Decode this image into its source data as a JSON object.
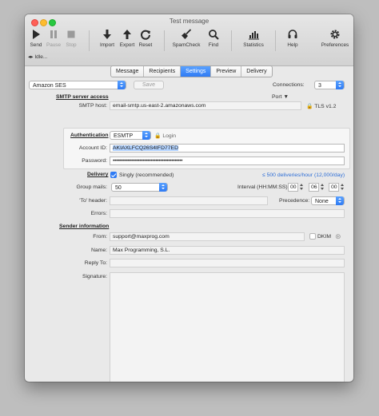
{
  "window": {
    "title": "Test message"
  },
  "toolbar": [
    {
      "label": "Send",
      "icon": "play-icon",
      "enabled": true
    },
    {
      "label": "Pause",
      "icon": "pause-icon",
      "enabled": false
    },
    {
      "label": "Stop",
      "icon": "stop-icon",
      "enabled": false
    },
    {
      "label": "Import",
      "icon": "arrow-down-icon",
      "enabled": true
    },
    {
      "label": "Export",
      "icon": "arrow-up-icon",
      "enabled": true
    },
    {
      "label": "Reset",
      "icon": "refresh-icon",
      "enabled": true
    },
    {
      "label": "SpamCheck",
      "icon": "broom-icon",
      "enabled": true
    },
    {
      "label": "Find",
      "icon": "search-icon",
      "enabled": true
    },
    {
      "label": "Statistics",
      "icon": "bar-chart-icon",
      "enabled": true
    },
    {
      "label": "Help",
      "icon": "headset-icon",
      "enabled": true
    },
    {
      "label": "Preferences",
      "icon": "gear-icon",
      "enabled": true
    }
  ],
  "status": {
    "text": "Idle..."
  },
  "tabs": [
    {
      "label": "Message",
      "active": false
    },
    {
      "label": "Recipients",
      "active": false
    },
    {
      "label": "Settings",
      "active": true
    },
    {
      "label": "Preview",
      "active": false
    },
    {
      "label": "Delivery",
      "active": false
    }
  ],
  "settings": {
    "profile": "Amazon SES",
    "save_label": "Save",
    "connections_label": "Connections:",
    "connections_value": "3",
    "smtp_section": "SMTP server access",
    "port_label": "Port ▼",
    "smtp_host_label": "SMTP host:",
    "smtp_host_value": "email-smtp.us-east-2.amazonaws.com",
    "tls_label": "TLS v1.2",
    "auth_label": "Authentication",
    "auth_value": "ESMTP",
    "login_label": "Login",
    "account_id_label": "Account ID:",
    "account_id_value": "AKIAXLFCQ26S4IFD77ED",
    "password_label": "Password:",
    "password_value": "••••••••••••••••••••••••••••••••••••••••••••",
    "delivery_section": "Delivery",
    "singly_label": "Singly (recommended)",
    "rate_text": "≤ 500 deliveries/hour (12,000/day)",
    "group_mails_label": "Group mails:",
    "group_mails_value": "50",
    "interval_label": "Interval (HH:MM:SS):",
    "interval_h": "00",
    "interval_m": "06",
    "interval_s": "00",
    "to_header_label": "'To' header:",
    "precedence_label": "Precedence:",
    "precedence_value": "None",
    "errors_label": "Errors:",
    "sender_section": "Sender information",
    "from_label": "From:",
    "from_value": "support@maxprog.com",
    "dkim_label": "DKIM",
    "name_label": "Name:",
    "name_value": "Max Programming, S.L.",
    "reply_to_label": "Reply To:",
    "signature_label": "Signature:"
  },
  "colors": {
    "accent": "#2f7bf4",
    "link": "#2f6fd6"
  }
}
